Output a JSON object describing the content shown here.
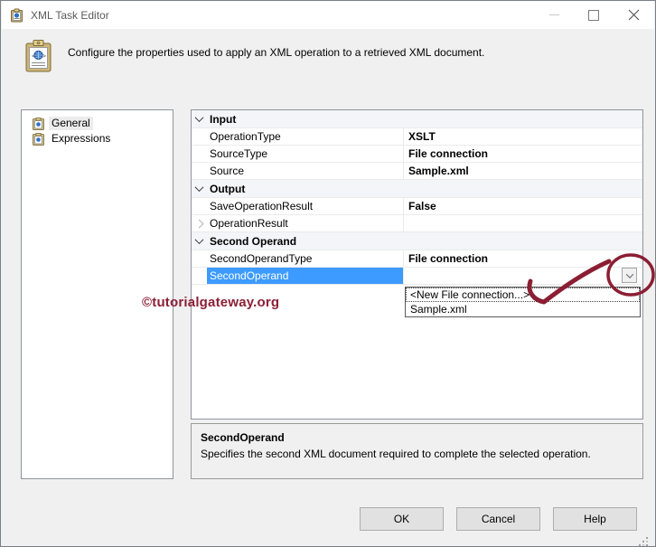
{
  "window": {
    "title": "XML Task Editor"
  },
  "header": {
    "description": "Configure the properties used to apply an XML operation to a retrieved XML document."
  },
  "sidebar": {
    "items": [
      {
        "label": "General",
        "selected": true
      },
      {
        "label": "Expressions",
        "selected": false
      }
    ]
  },
  "property_grid": {
    "sections": [
      {
        "name": "Input",
        "rows": [
          {
            "name": "OperationType",
            "value": "XSLT"
          },
          {
            "name": "SourceType",
            "value": "File connection"
          },
          {
            "name": "Source",
            "value": "Sample.xml"
          }
        ]
      },
      {
        "name": "Output",
        "rows": [
          {
            "name": "SaveOperationResult",
            "value": "False"
          },
          {
            "name": "OperationResult",
            "value": "",
            "expandable": true
          }
        ]
      },
      {
        "name": "Second Operand",
        "rows": [
          {
            "name": "SecondOperandType",
            "value": "File connection"
          },
          {
            "name": "SecondOperand",
            "value": "",
            "selected": true,
            "has_dropdown": true
          }
        ]
      }
    ]
  },
  "dropdown": {
    "items": [
      "<New File connection...>",
      "Sample.xml"
    ]
  },
  "description_panel": {
    "title": "SecondOperand",
    "text": "Specifies the second XML document required to complete the selected operation."
  },
  "buttons": {
    "ok": "OK",
    "cancel": "Cancel",
    "help": "Help"
  },
  "watermark": {
    "text": "©tutorialgateway.org"
  },
  "colors": {
    "selection": "#3d9bff",
    "annotation": "#8b1e33",
    "titlebar": "#ffffff",
    "body": "#f0f0f0"
  }
}
